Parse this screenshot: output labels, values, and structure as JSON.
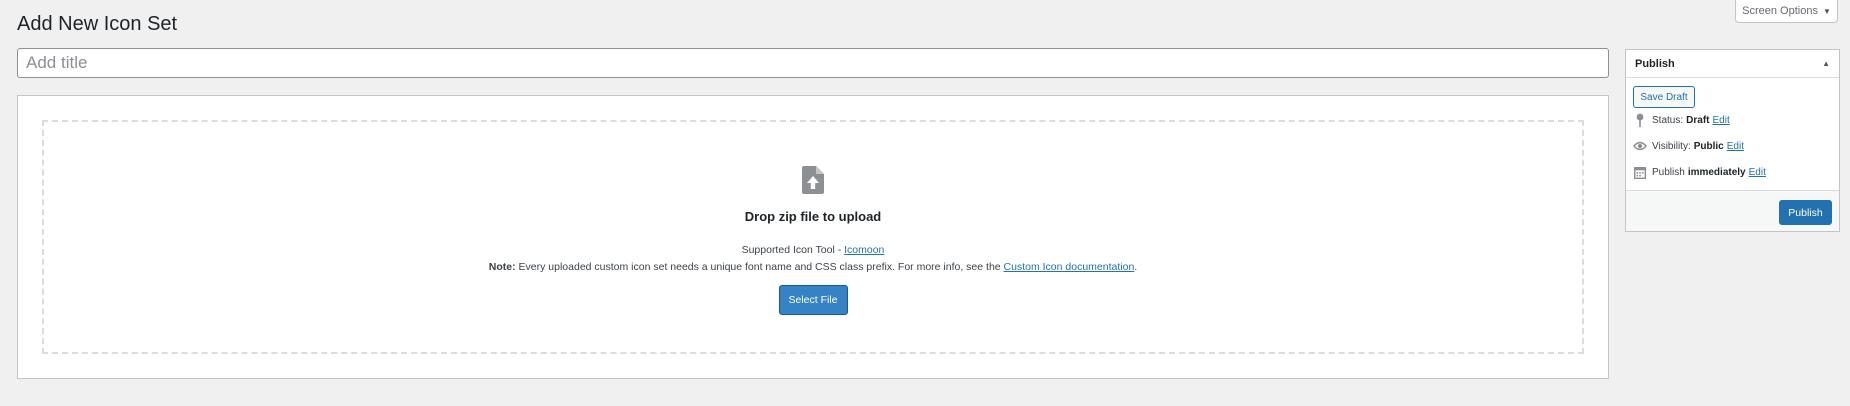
{
  "screen_options": {
    "label": "Screen Options",
    "arrow": "▼"
  },
  "page": {
    "title": "Add New Icon Set"
  },
  "title_input": {
    "placeholder": "Add title",
    "value": ""
  },
  "upload": {
    "icon": "file-upload-icon",
    "heading": "Drop zip file to upload",
    "supported_prefix": "Supported Icon Tool - ",
    "supported_tool": "Icomoon",
    "note_label": "Note:",
    "note_text": " Every uploaded custom icon set needs a unique font name and CSS class prefix. For more info, see the ",
    "note_link": "Custom Icon documentation",
    "note_suffix": ".",
    "select_button": "Select File"
  },
  "publish_box": {
    "title": "Publish",
    "toggle": "▲",
    "save_draft": "Save Draft",
    "status": {
      "icon": "pin-icon",
      "label": "Status:",
      "value": "Draft",
      "edit": "Edit"
    },
    "visibility": {
      "icon": "eye-icon",
      "label": "Visibility:",
      "value": "Public",
      "edit": "Edit"
    },
    "schedule": {
      "icon": "calendar-icon",
      "label": "Publish",
      "value": "immediately",
      "edit": "Edit"
    },
    "publish_button": "Publish"
  },
  "colors": {
    "background": "#f0f0f1",
    "primary": "#2271b1",
    "select_button": "#3582c4",
    "border": "#c3c4c7",
    "dashed_border": "#dcdcde"
  }
}
